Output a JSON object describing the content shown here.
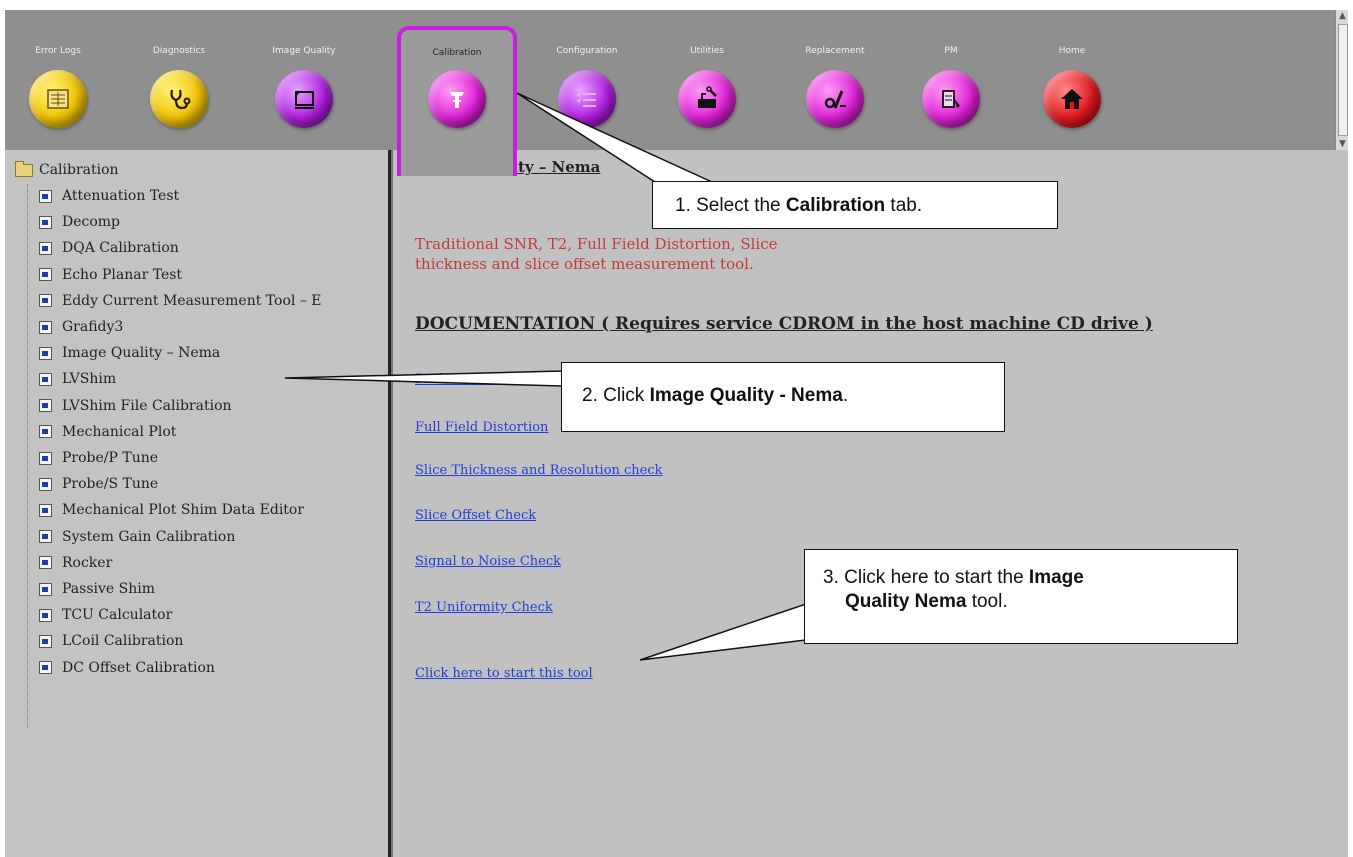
{
  "tabs": [
    {
      "label": "Error Logs",
      "icon": "error-log-icon",
      "color": "yellow"
    },
    {
      "label": "Diagnostics",
      "icon": "stethoscope-icon",
      "color": "yellow"
    },
    {
      "label": "Image Quality",
      "icon": "image-quality-icon",
      "color": "purple"
    },
    {
      "label": "Calibration",
      "icon": "calibration-icon",
      "color": "magenta",
      "active": true
    },
    {
      "label": "Configuration",
      "icon": "configuration-icon",
      "color": "purple"
    },
    {
      "label": "Utilities",
      "icon": "utilities-icon",
      "color": "magenta"
    },
    {
      "label": "Replacement",
      "icon": "replacement-icon",
      "color": "magenta"
    },
    {
      "label": "PM",
      "icon": "pm-icon",
      "color": "magenta"
    },
    {
      "label": "Home",
      "icon": "home-icon",
      "color": "red"
    }
  ],
  "tree": {
    "root": "Calibration",
    "items": [
      "Attenuation Test",
      "Decomp",
      "DQA Calibration",
      "Echo Planar Test",
      "Eddy Current Measurement Tool – E",
      "Grafidy3",
      "Image Quality – Nema",
      "LVShim",
      "LVShim File Calibration",
      "Mechanical Plot",
      "Probe/P Tune",
      "Probe/S Tune",
      "Mechanical Plot Shim Data Editor",
      "System Gain Calibration",
      "Rocker",
      "Passive Shim",
      "TCU Calculator",
      "LCoil Calibration",
      "DC Offset Calibration"
    ]
  },
  "content": {
    "title": "Image Quality – Nema",
    "description_line1": "Traditional SNR, T2, Full Field Distortion, Slice",
    "description_line2": "thickness and slice offset measurement tool.",
    "doc_heading": "DOCUMENTATION ( Requires service CDROM in the host machine CD drive )",
    "links": [
      "Performance Check",
      "Full Field Distortion",
      "Slice Thickness and Resolution check",
      "Slice Offset Check",
      "Signal to Noise Check",
      "T2 Uniformity Check",
      "Click here to start this tool"
    ]
  },
  "callouts": {
    "c1_pre": "1.  Select the ",
    "c1_bold": "Calibration",
    "c1_post": " tab.",
    "c2_pre": "2.    Click ",
    "c2_bold": "Image Quality - Nema",
    "c2_post": ".",
    "c3_pre": "3.  Click here to start the ",
    "c3_bold1": "Image",
    "c3_bold2": "Quality Nema",
    "c3_post": " tool."
  },
  "colors": {
    "active_tab_border": "#c81ee0",
    "description_text": "#c23a3a",
    "link": "#1f3fd6"
  }
}
